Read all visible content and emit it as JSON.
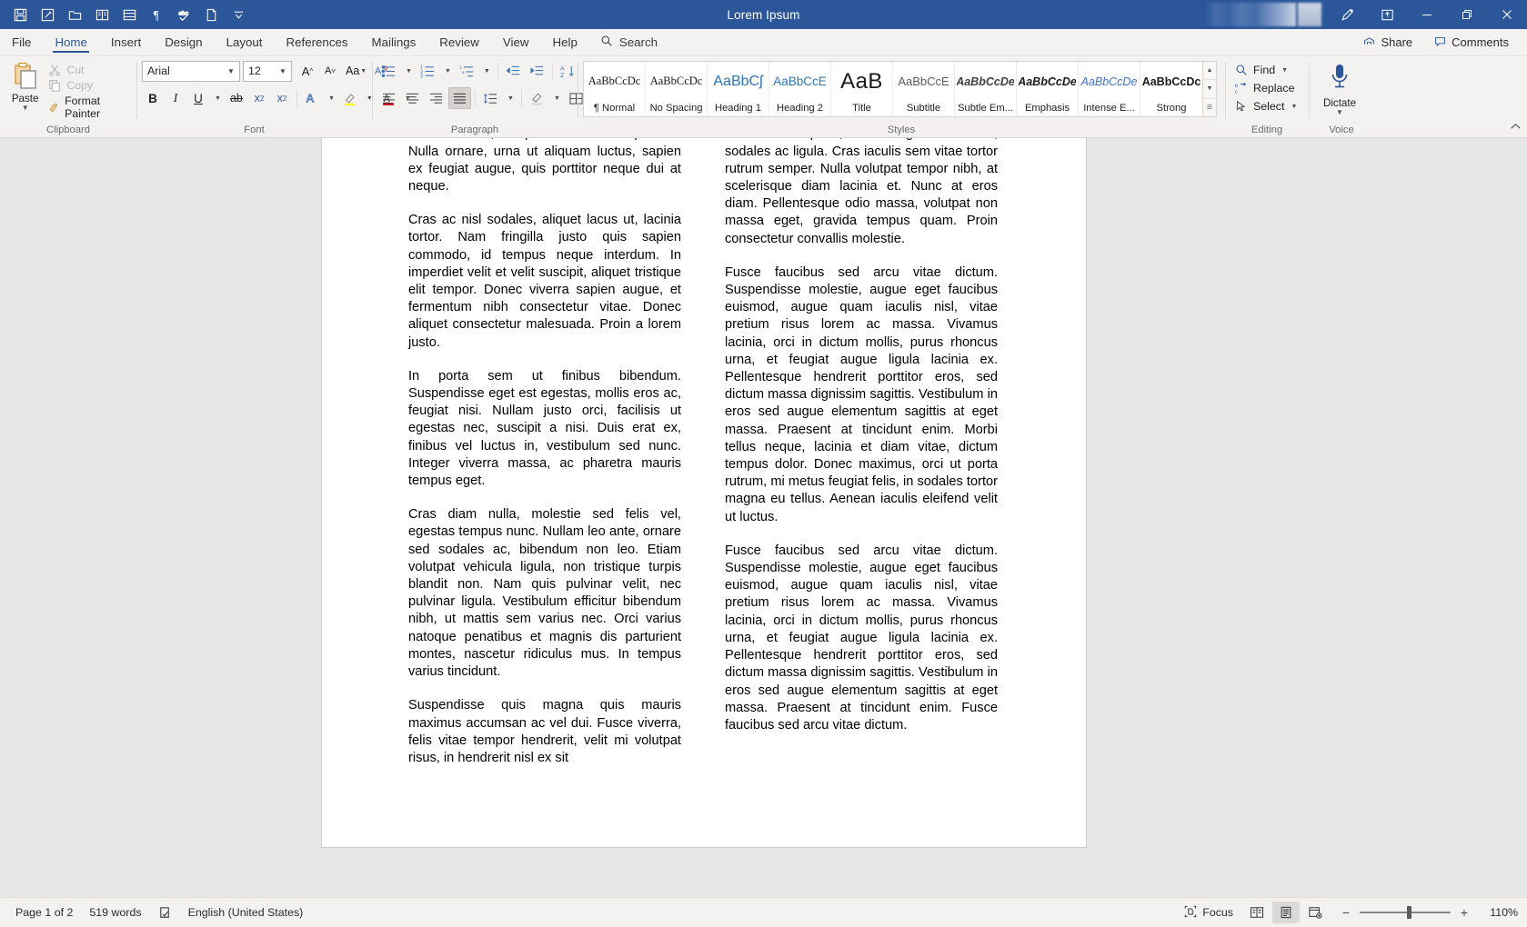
{
  "window": {
    "title": "Lorem Ipsum",
    "quick_access": [
      {
        "name": "save-icon",
        "label": "Save"
      },
      {
        "name": "autosave-icon",
        "label": "AutoSave"
      },
      {
        "name": "open-folder-icon",
        "label": "Open"
      },
      {
        "name": "read-mode-icon",
        "label": "Read Mode"
      },
      {
        "name": "print-layout-icon",
        "label": "Print Layout"
      },
      {
        "name": "paragraph-marks-icon",
        "label": "Show/Hide ¶"
      },
      {
        "name": "spelling-check-icon",
        "label": "Spelling & Grammar"
      },
      {
        "name": "new-document-icon",
        "label": "New"
      },
      {
        "name": "customize-quick-access-icon",
        "label": "Customize Quick Access Toolbar"
      }
    ],
    "controls": {
      "ribbon_display": "Ribbon Display Options",
      "minimize": "Minimize",
      "restore": "Restore Down",
      "close": "Close"
    }
  },
  "tabs": [
    {
      "label": "File",
      "active": false
    },
    {
      "label": "Home",
      "active": true
    },
    {
      "label": "Insert",
      "active": false
    },
    {
      "label": "Design",
      "active": false
    },
    {
      "label": "Layout",
      "active": false
    },
    {
      "label": "References",
      "active": false
    },
    {
      "label": "Mailings",
      "active": false
    },
    {
      "label": "Review",
      "active": false
    },
    {
      "label": "View",
      "active": false
    },
    {
      "label": "Help",
      "active": false
    }
  ],
  "search": {
    "label": "Search",
    "placeholder": "Search"
  },
  "tabbar_right": {
    "share": "Share",
    "comments": "Comments"
  },
  "ribbon": {
    "clipboard": {
      "label": "Clipboard",
      "paste": "Paste",
      "cut": "Cut",
      "copy": "Copy",
      "format_painter": "Format Painter"
    },
    "font": {
      "label": "Font",
      "font_family": "Arial",
      "font_size": "12",
      "grow_font": "Increase Font Size",
      "shrink_font": "Decrease Font Size",
      "change_case": "Aa",
      "clear_formatting": "Clear All Formatting",
      "bold": "B",
      "italic": "I",
      "underline": "U",
      "strikethrough": "ab",
      "subscript": "x",
      "superscript": "x",
      "text_effects": "A",
      "text_highlight": "Text Highlight Color",
      "font_color": "A"
    },
    "paragraph": {
      "label": "Paragraph",
      "bullets": "Bullets",
      "numbering": "Numbering",
      "multilevel": "Multilevel List",
      "decrease_indent": "Decrease Indent",
      "increase_indent": "Increase Indent",
      "sort": "Sort",
      "show_marks": "Show/Hide",
      "align_left": "Align Left",
      "align_center": "Center",
      "align_right": "Align Right",
      "justify": "Justify",
      "justify_active": true,
      "line_spacing": "Line and Paragraph Spacing",
      "shading": "Shading",
      "borders": "Borders"
    },
    "styles": {
      "label": "Styles",
      "items": [
        {
          "preview": "AaBbCcDc",
          "name": "¶ Normal",
          "cls": "sp-normal"
        },
        {
          "preview": "AaBbCcDc",
          "name": "No Spacing",
          "cls": "sp-nospace"
        },
        {
          "preview": "AaBbCʃ",
          "name": "Heading 1",
          "cls": "sp-h1"
        },
        {
          "preview": "AaBbCcE",
          "name": "Heading 2",
          "cls": "sp-h2"
        },
        {
          "preview": "AaB",
          "name": "Title",
          "cls": "sp-title"
        },
        {
          "preview": "AaBbCcE",
          "name": "Subtitle",
          "cls": "sp-sub"
        },
        {
          "preview": "AaBbCcDe",
          "name": "Subtle Em...",
          "cls": "sp-subem"
        },
        {
          "preview": "AaBbCcDe",
          "name": "Emphasis",
          "cls": "sp-em"
        },
        {
          "preview": "AaBbCcDe",
          "name": "Intense E...",
          "cls": "sp-intense"
        },
        {
          "preview": "AaBbCcDc",
          "name": "Strong",
          "cls": "sp-strong"
        }
      ]
    },
    "editing": {
      "label": "Editing",
      "find": "Find",
      "replace": "Replace",
      "select": "Select"
    },
    "voice": {
      "label": "Voice",
      "dictate": "Dictate"
    }
  },
  "document": {
    "left_column": [
      "Maecenas felis urna, fermentum et quam quis, aliquet lobortis tortor. Nulla facilisis rhoncus lacus, non placerat sem tristique sed. Nulla ornare, urna ut aliquam luctus, sapien ex feugiat augue, quis porttitor neque dui at neque.",
      "Cras ac nisl sodales, aliquet lacus ut, lacinia tortor. Nam fringilla justo quis sapien commodo, id tempus neque interdum. In imperdiet velit et velit suscipit, aliquet tristique elit tempor. Donec viverra sapien augue, et fermentum nibh consectetur vitae. Donec aliquet consectetur malesuada. Proin a lorem justo.",
      "In porta sem ut finibus bibendum. Suspendisse eget est egestas, mollis eros ac, feugiat nisi. Nullam justo orci, facilisis ut egestas nec, suscipit a nisi. Duis erat ex, finibus vel luctus in, vestibulum sed nunc. Integer viverra massa, ac pharetra mauris tempus eget.",
      "Cras diam nulla, molestie sed felis vel, egestas tempus nunc. Nullam leo ante, ornare sed sodales ac, bibendum non leo. Etiam volutpat vehicula ligula, non tristique turpis blandit non. Nam quis pulvinar velit, nec pulvinar ligula. Vestibulum efficitur bibendum nibh, ut mattis sem varius nec. Orci varius natoque penatibus et magnis dis parturient montes, nascetur ridiculus mus. In tempus varius tincidunt.",
      "Suspendisse quis magna quis mauris maximus accumsan ac vel dui. Fusce viverra, felis vitae tempor hendrerit, velit mi volutpat risus, in hendrerit nisl ex sit"
    ],
    "right_column": [
      "amet ante. Maecenas quis dignissim ex. Aliquam eget commodo neque. In nec cursus eros. Nunc quam, mattis eget dictum in, sodales ac ligula. Cras iaculis sem vitae tortor rutrum semper. Nulla volutpat tempor nibh, at scelerisque diam lacinia et. Nunc at eros diam. Pellentesque odio massa, volutpat non massa eget, gravida tempus quam. Proin consectetur convallis molestie.",
      "Fusce faucibus sed arcu vitae dictum. Suspendisse molestie, augue eget faucibus euismod, augue quam iaculis nisl, vitae pretium risus lorem ac massa. Vivamus lacinia, orci in dictum mollis, purus rhoncus urna, et feugiat augue ligula lacinia ex. Pellentesque hendrerit porttitor eros, sed dictum massa dignissim sagittis. Vestibulum in eros sed augue elementum sagittis at eget massa. Praesent at tincidunt enim. Morbi tellus neque, lacinia et diam vitae, dictum tempus dolor. Donec maximus, orci ut porta rutrum, mi metus feugiat felis, in sodales tortor magna eu tellus. Aenean iaculis eleifend velit ut luctus.",
      "Fusce faucibus sed arcu vitae dictum. Suspendisse molestie, augue eget faucibus euismod, augue quam iaculis nisl, vitae pretium risus lorem ac massa. Vivamus lacinia, orci in dictum mollis, purus rhoncus urna, et feugiat augue ligula lacinia ex. Pellentesque hendrerit porttitor eros, sed dictum massa dignissim sagittis. Vestibulum in eros sed augue elementum sagittis at eget massa. Praesent at tincidunt enim. Fusce faucibus sed arcu vitae dictum."
    ]
  },
  "status": {
    "page": "Page 1 of 2",
    "words": "519 words",
    "proofing_icon": "proofing-errors-icon",
    "language": "English (United States)",
    "focus": "Focus",
    "views": [
      {
        "name": "read-mode-view",
        "active": false
      },
      {
        "name": "print-layout-view",
        "active": true
      },
      {
        "name": "web-layout-view",
        "active": false
      }
    ],
    "zoom_out": "−",
    "zoom_in": "+",
    "zoom_level": "110%"
  },
  "colors": {
    "titlebar": "#2b579a",
    "ribbon": "#f3f2f1",
    "accent": "#2b579a",
    "doc_bg": "#e6e6e6",
    "page": "#ffffff"
  }
}
